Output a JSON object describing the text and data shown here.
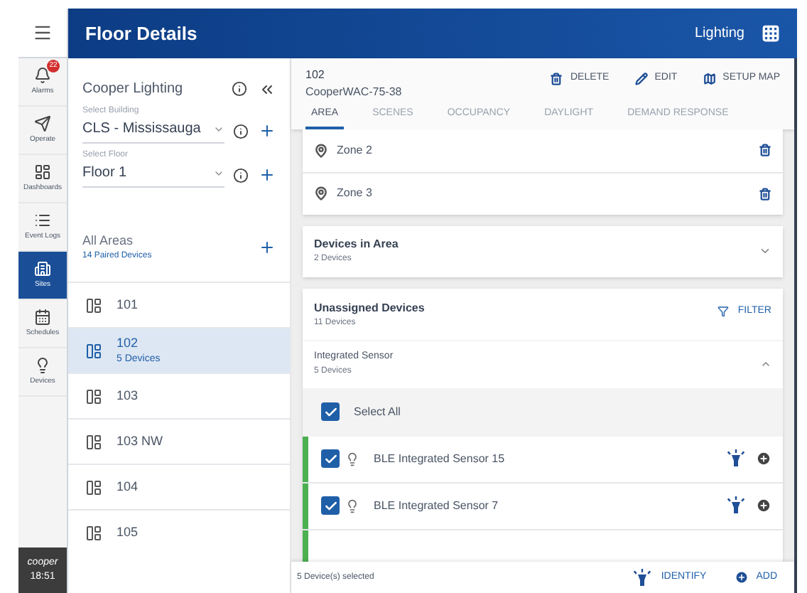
{
  "app_bar": {
    "title": "Floor Details",
    "section": "Lighting"
  },
  "nav": [
    {
      "label": "Alarms",
      "badge": "22",
      "selected": false
    },
    {
      "label": "Operate",
      "selected": false
    },
    {
      "label": "Dashboards",
      "selected": false
    },
    {
      "label": "Event Logs",
      "selected": false
    },
    {
      "label": "Sites",
      "selected": true
    },
    {
      "label": "Schedules",
      "selected": false
    },
    {
      "label": "Devices",
      "selected": false
    }
  ],
  "brand": {
    "logo": "cooper",
    "time": "18:51"
  },
  "site": {
    "name": "Cooper Lighting",
    "building": {
      "label": "Select Building",
      "value": "CLS - Mississauga"
    },
    "floor": {
      "label": "Select Floor",
      "value": "Floor 1"
    }
  },
  "all_areas": {
    "title": "All Areas",
    "subtitle": "14 Paired Devices"
  },
  "areas": [
    {
      "name": "101",
      "selected": false
    },
    {
      "name": "102",
      "subtitle": "5 Devices",
      "selected": true
    },
    {
      "name": "103",
      "selected": false
    },
    {
      "name": "103 NW",
      "selected": false
    },
    {
      "name": "104",
      "selected": false
    },
    {
      "name": "105",
      "selected": false
    }
  ],
  "area_header": {
    "name": "102",
    "controller": "CooperWAC-75-38",
    "actions": [
      "DELETE",
      "EDIT",
      "SETUP MAP"
    ]
  },
  "tabs": [
    {
      "label": "AREA",
      "selected": true
    },
    {
      "label": "SCENES",
      "selected": false
    },
    {
      "label": "OCCUPANCY",
      "selected": false
    },
    {
      "label": "DAYLIGHT",
      "selected": false
    },
    {
      "label": "DEMAND RESPONSE",
      "selected": false
    }
  ],
  "zones": [
    {
      "name": "Zone 2"
    },
    {
      "name": "Zone 3"
    }
  ],
  "devices_in_area": {
    "title": "Devices in Area",
    "count": "2 Devices",
    "expanded": false
  },
  "unassigned": {
    "title": "Unassigned Devices",
    "count": "11 Devices",
    "filter": "FILTER",
    "group": {
      "title": "Integrated Sensor",
      "count": "5 Devices",
      "expanded": true
    },
    "select_all": {
      "label": "Select All",
      "checked": true
    },
    "devices": [
      {
        "name": "BLE Integrated Sensor 15",
        "checked": true
      },
      {
        "name": "BLE Integrated Sensor 7",
        "checked": true
      }
    ]
  },
  "footer": {
    "selection": "5 Device(s) selected",
    "identify": "IDENTIFY",
    "add": "ADD"
  }
}
